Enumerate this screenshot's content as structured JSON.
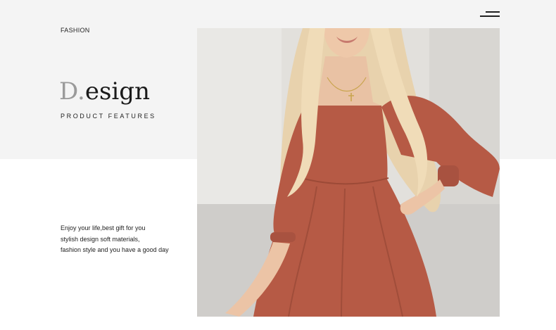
{
  "header": {
    "section_label": "FASHION",
    "menu_icon": "hamburger-menu-icon"
  },
  "hero": {
    "title_initial": "D.",
    "title_rest": "esign",
    "subtitle": "PRODUCT FEATURES"
  },
  "description": {
    "lines": [
      "Enjoy your life,best gift for you",
      "stylish design soft materials,",
      "fashion style and you have a good day"
    ]
  },
  "colors": {
    "top_band": "#f4f4f4",
    "dress": "#b65a45",
    "hair": "#e8d2ad",
    "title_accent": "#9a9a9a"
  }
}
